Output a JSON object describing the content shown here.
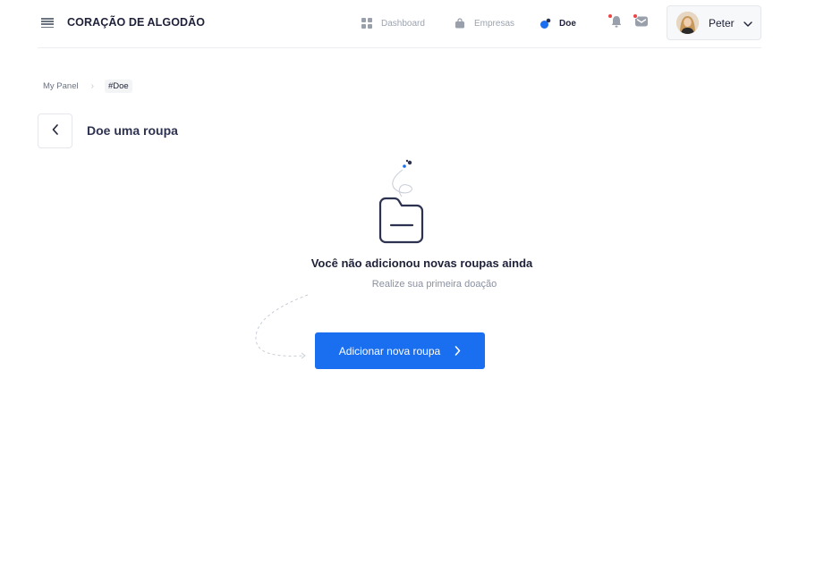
{
  "header": {
    "brand": "CORAÇÃO DE ALGODÃO",
    "nav": [
      {
        "label": "Dashboard",
        "icon": "grid-icon",
        "active": false
      },
      {
        "label": "Empresas",
        "icon": "bag-icon",
        "active": false
      },
      {
        "label": "Doe",
        "icon": "drop-icon",
        "active": true
      }
    ],
    "notifications": [
      "bell-icon",
      "mail-icon"
    ],
    "user": {
      "name": "Peter"
    }
  },
  "breadcrumb": {
    "items": [
      "My Panel",
      "#Doe"
    ]
  },
  "page": {
    "title": "Doe uma roupa"
  },
  "empty_state": {
    "title": "Você não adicionou novas roupas ainda",
    "subtitle": "Realize sua primeira doação",
    "cta_label": "Adicionar nova roupa"
  },
  "colors": {
    "primary": "#1a6ef0",
    "text_dark": "#1e2139",
    "muted": "#9ca3af",
    "notification": "#ef4444"
  }
}
